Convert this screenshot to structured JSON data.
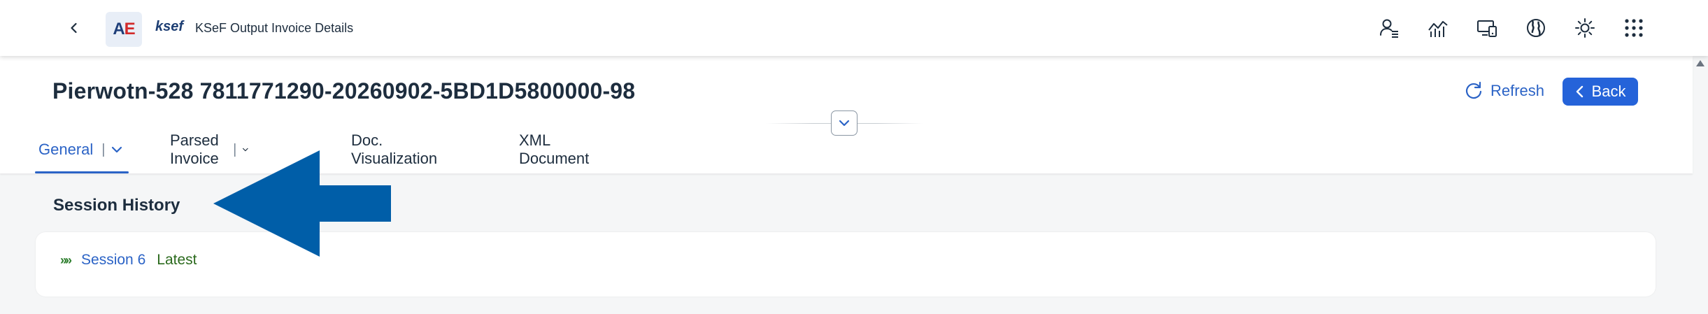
{
  "shell": {
    "logo_a": "A",
    "logo_e": "E",
    "app_name": "ksef",
    "app_title": "KSeF Output Invoice Details",
    "actions": [
      "user-menu-icon",
      "analytics-icon",
      "devices-icon",
      "globe-icon",
      "theme-icon",
      "app-launcher-icon"
    ]
  },
  "header": {
    "title": "Pierwotn-528 7811771290-20260902-5BD1D5800000-98",
    "refresh_label": "Refresh",
    "back_label": "Back"
  },
  "tabs": [
    {
      "label": "General",
      "has_menu": true,
      "active": true
    },
    {
      "label": "Parsed Invoice",
      "has_menu": true,
      "active": false
    },
    {
      "label": "Doc. Visualization",
      "has_menu": false,
      "active": false
    },
    {
      "label": "XML Document",
      "has_menu": false,
      "active": false
    }
  ],
  "tab_separator": "|",
  "section": {
    "title": "Session History",
    "session_link": "Session 6",
    "session_badge": "Latest",
    "session_marker": "»»"
  },
  "colors": {
    "accent": "#2b63c6",
    "back_button": "#2563d9",
    "arrow": "#005ea8",
    "latest": "#2b6a1d"
  }
}
